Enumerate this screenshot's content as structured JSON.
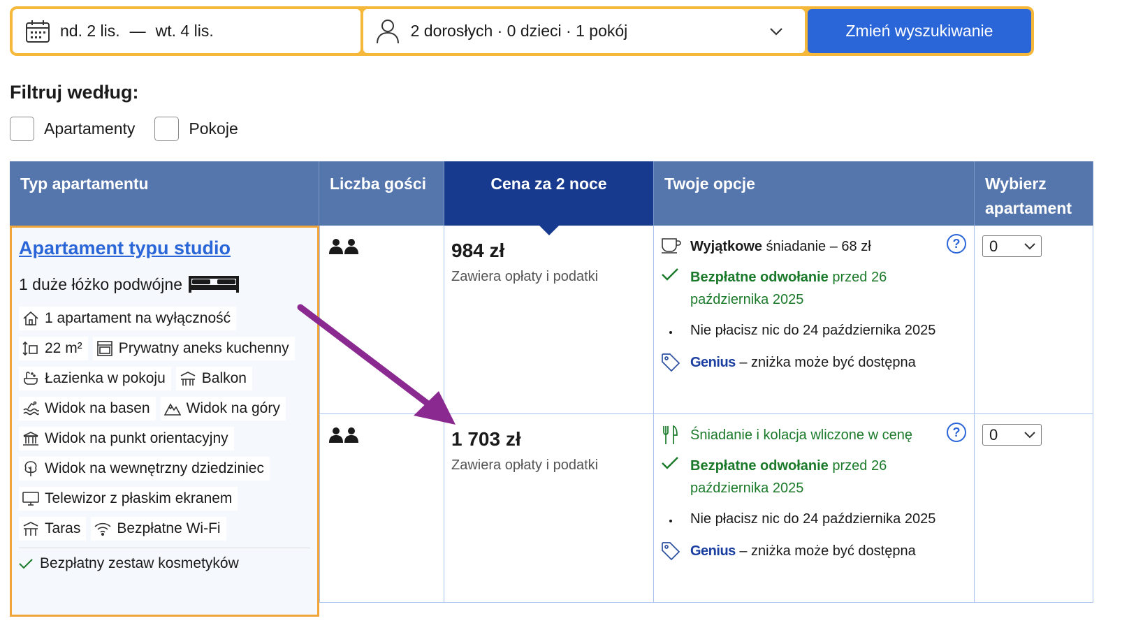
{
  "search": {
    "date_from": "nd. 2 lis.",
    "date_sep": "—",
    "date_to": "wt. 4 lis.",
    "guests": "2 dorosłych · 0 dzieci · 1 pokój",
    "button": "Zmień wyszukiwanie",
    "icons": {
      "dates": "calendar-icon",
      "guests": "person-icon",
      "dropdown": "chevron-down-icon"
    }
  },
  "filters": {
    "title": "Filtruj według:",
    "options": [
      {
        "label": "Apartamenty",
        "checked": false
      },
      {
        "label": "Pokoje",
        "checked": false
      }
    ]
  },
  "table": {
    "headers": {
      "type": "Typ apartamentu",
      "guests": "Liczba gości",
      "price": "Cena za 2 noce",
      "options": "Twoje opcje",
      "select_line1": "Wybierz",
      "select_line2": "apartament"
    },
    "room": {
      "name": "Apartament typu studio",
      "bed": "1 duże łóżko podwójne",
      "facilities": {
        "exclusive": "1 apartament na wyłączność",
        "size": "22 m²",
        "kitchenette": "Prywatny aneks kuchenny",
        "bathroom": "Łazienka w pokoju",
        "balcony": "Balkon",
        "pool_view": "Widok na basen",
        "mountain_view": "Widok na góry",
        "landmark_view": "Widok na punkt orientacyjny",
        "courtyard_view": "Widok na wewnętrzny dziedziniec",
        "tv": "Telewizor z płaskim ekranem",
        "terrace": "Taras",
        "wifi": "Bezpłatne Wi-Fi"
      },
      "perk": "Bezpłatny zestaw kosmetyków"
    },
    "offers": [
      {
        "guests": 2,
        "price": "984 zł",
        "price_note": "Zawiera opłaty i podatki",
        "meal_bold": "Wyjątkowe",
        "meal_rest": " śniadanie – 68 zł",
        "cancel_bold": "Bezpłatne odwołanie",
        "cancel_rest": " przed 26 października 2025",
        "pay": "Nie płacisz nic do 24 października 2025",
        "genius": "Genius",
        "genius_rest": " – zniżka może być dostępna",
        "select_value": "0",
        "help": "?"
      },
      {
        "guests": 2,
        "price": "1 703 zł",
        "price_note": "Zawiera opłaty i podatki",
        "meal": "Śniadanie i kolacja wliczone w cenę",
        "cancel_bold": "Bezpłatne odwołanie",
        "cancel_rest": " przed 26 października 2025",
        "pay": "Nie płacisz nic do 24 października 2025",
        "genius": "Genius",
        "genius_rest": " – zniżka może być dostępna",
        "select_value": "0",
        "help": "?"
      }
    ]
  },
  "colors": {
    "accent_yellow": "#f5b83b",
    "button_blue": "#2b66d9",
    "header_blue": "#5575ad",
    "header_dark": "#173a8f",
    "link_blue": "#2b66d9",
    "green": "#1b7a2a",
    "annotation_arrow": "#8a2a91"
  }
}
